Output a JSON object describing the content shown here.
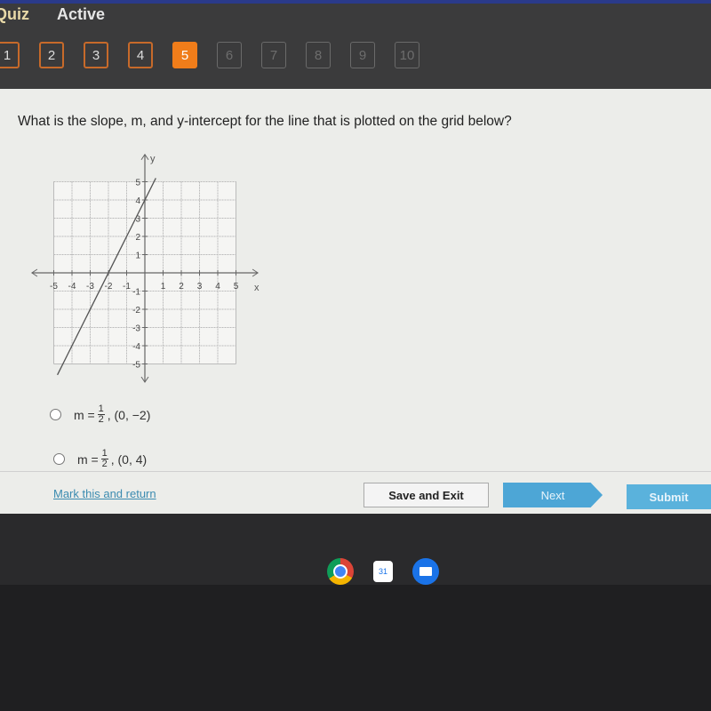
{
  "header": {
    "title": "Quiz",
    "status": "Active"
  },
  "question_nav": [
    {
      "label": "1",
      "state": "answered"
    },
    {
      "label": "2",
      "state": "answered"
    },
    {
      "label": "3",
      "state": "answered"
    },
    {
      "label": "4",
      "state": "answered"
    },
    {
      "label": "5",
      "state": "current"
    },
    {
      "label": "6",
      "state": "locked"
    },
    {
      "label": "7",
      "state": "locked"
    },
    {
      "label": "8",
      "state": "locked"
    },
    {
      "label": "9",
      "state": "locked"
    },
    {
      "label": "10",
      "state": "locked"
    }
  ],
  "question": {
    "text": "What is the slope, m, and y-intercept for the line that is plotted on the grid below?"
  },
  "chart_data": {
    "type": "line",
    "xlabel": "x",
    "ylabel": "y",
    "xlim": [
      -5,
      5
    ],
    "ylim": [
      -5,
      5
    ],
    "xticks": [
      "-5",
      "-4",
      "-3",
      "-2",
      "-1",
      "1",
      "2",
      "3",
      "4",
      "5"
    ],
    "yticks": [
      "5",
      "4",
      "3",
      "2",
      "1",
      "-1",
      "-2",
      "-3",
      "-4",
      "-5"
    ],
    "grid": true,
    "line": {
      "x": [
        -4.8,
        0.6
      ],
      "y": [
        -5.6,
        5.2
      ],
      "through": [
        [
          -2,
          0
        ],
        [
          0,
          4
        ]
      ]
    }
  },
  "options": [
    {
      "m_num": "1",
      "m_den": "2",
      "prefix": "m =",
      "point": ", (0, −2)"
    },
    {
      "m_num": "1",
      "m_den": "2",
      "prefix": "m =",
      "point": ", (0, 4)"
    }
  ],
  "footer": {
    "mark_label": "Mark this and return",
    "save_label": "Save and Exit",
    "next_label": "Next",
    "submit_label": "Submit"
  },
  "taskbar": {
    "icons": [
      "chrome-icon",
      "calendar-icon",
      "files-icon"
    ],
    "calendar_day": "31"
  },
  "colors": {
    "accent": "#f07d1a",
    "button_blue": "#4da6d6"
  }
}
